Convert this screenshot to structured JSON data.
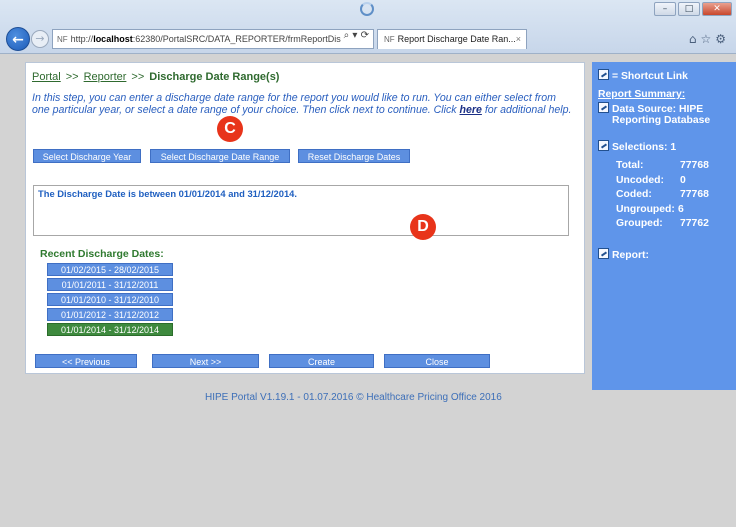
{
  "browser": {
    "address_url_prefix": "http://",
    "address_url_host": "localhost",
    "address_url_rest": ":62380/PortalSRC/DATA_REPORTER/frmReportDis",
    "address_tools": "⌕ ▾ ⟳",
    "tab_title": "Report Discharge Date Ran...",
    "tab_close": "×",
    "favicon_text": "NF"
  },
  "breadcrumb": {
    "portal": "Portal",
    "sep1": ">>",
    "reporter": "Reporter",
    "sep2": ">>",
    "current": "Discharge Date Range(s)"
  },
  "intro": {
    "text_before_link": "In this step, you can enter a discharge date range for the report you would like to run. You can either select from one particular year, or select a date range of your choice. Then click next to continue. Click ",
    "link": "here",
    "text_after_link": " for additional help."
  },
  "buttons": {
    "select_year": "Select Discharge Year",
    "select_range": "Select Discharge Date Range",
    "reset": "Reset Discharge Dates",
    "previous": "<< Previous",
    "next": "Next >>",
    "create": "Create",
    "close": "Close"
  },
  "description": "The Discharge Date is between 01/01/2014 and 31/12/2014.",
  "recent": {
    "title": "Recent Discharge Dates:",
    "items": [
      "01/02/2015 - 28/02/2015",
      "01/01/2011 - 31/12/2011",
      "01/01/2010 - 31/12/2010",
      "01/01/2012 - 31/12/2012",
      "01/01/2014 - 31/12/2014"
    ],
    "selected_index": 4
  },
  "markers": {
    "c": "C",
    "d": "D"
  },
  "footer": "HIPE Portal V1.19.1 - 01.07.2016 © Healthcare Pricing Office 2016",
  "sidebar": {
    "shortcut_label": "= Shortcut Link",
    "report_summary": "Report Summary:",
    "data_source_line1": "Data Source: HIPE",
    "data_source_line2": "Reporting Database",
    "selections": "Selections: 1",
    "stats": [
      {
        "label": "Total:",
        "value": "77768"
      },
      {
        "label": "Uncoded:",
        "value": "0"
      },
      {
        "label": "Coded:",
        "value": "77768"
      },
      {
        "label": "Ungrouped:",
        "value": "6"
      },
      {
        "label": "Grouped:",
        "value": "77762"
      }
    ],
    "report": "Report:"
  },
  "colors": {
    "button_blue": "#5d8fe0",
    "selected_green": "#3e8a3e",
    "sidebar_blue": "#5f95ea",
    "marker_red": "#e8341a"
  }
}
